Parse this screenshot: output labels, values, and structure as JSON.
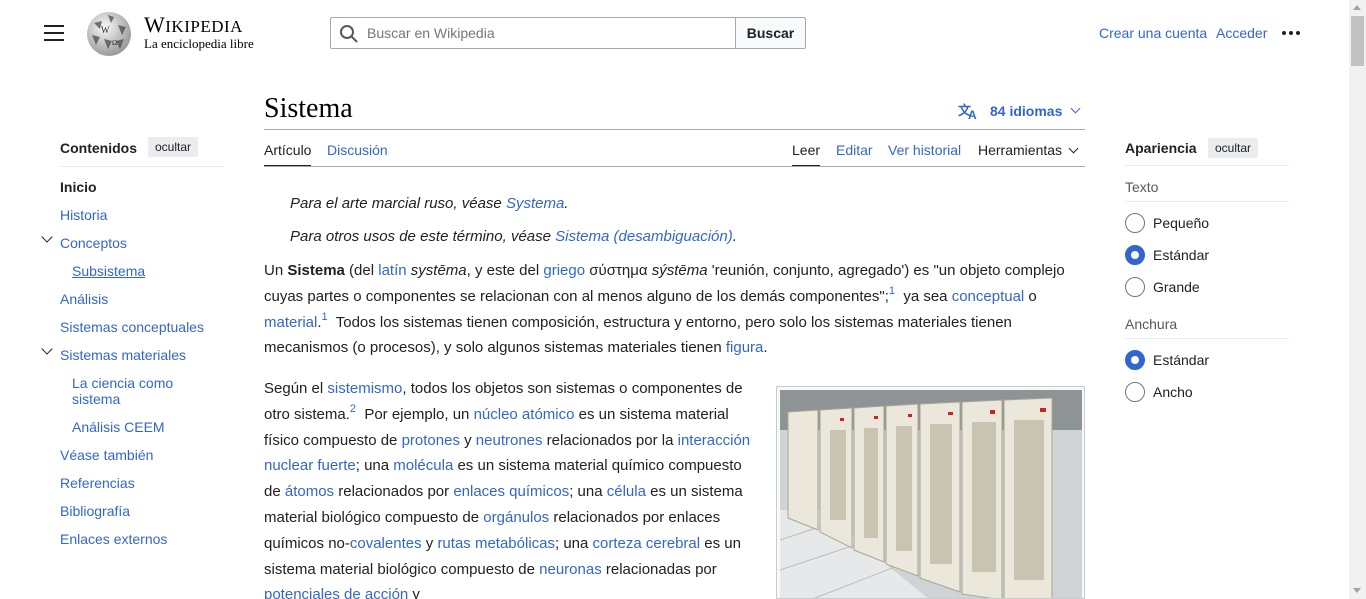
{
  "header": {
    "logo_wordmark": "Wikipedia",
    "logo_tagline": "La enciclopedia libre",
    "search_placeholder": "Buscar en Wikipedia",
    "search_button": "Buscar",
    "create_account": "Crear una cuenta",
    "login": "Acceder"
  },
  "article": {
    "title": "Sistema",
    "languages": "84 idiomas",
    "tabs": {
      "article": "Artículo",
      "talk": "Discusión",
      "read": "Leer",
      "edit": "Editar",
      "history": "Ver historial",
      "tools": "Herramientas"
    },
    "hatnote1": {
      "pre": "Para el arte marcial ruso, véase ",
      "link": "Systema",
      "post": "."
    },
    "hatnote2": {
      "pre": "Para otros usos de este término, véase ",
      "link": "Sistema (desambiguación)",
      "post": "."
    }
  },
  "toc": {
    "title": "Contenidos",
    "hide": "ocultar",
    "items": [
      "Inicio",
      "Historia",
      "Conceptos",
      "Subsistema",
      "Análisis",
      "Sistemas conceptuales",
      "Sistemas materiales",
      "La ciencia como",
      "sistema",
      "Análisis CEEM",
      "Véase también",
      "Referencias",
      "Bibliografía",
      "Enlaces externos"
    ]
  },
  "appearance": {
    "title": "Apariencia",
    "hide": "ocultar",
    "text_label": "Texto",
    "text_options": [
      "Pequeño",
      "Estándar",
      "Grande"
    ],
    "text_selected": "Estándar",
    "width_label": "Anchura",
    "width_options": [
      "Estándar",
      "Ancho"
    ],
    "width_selected": "Estándar"
  },
  "colors": {
    "link": "#3366cc",
    "text": "#202122",
    "radio_checked": "#3366cc"
  },
  "icons": [
    "menu-icon",
    "wikipedia-globe-logo",
    "search-icon",
    "translate-icon",
    "chevron-down-icon",
    "more-icon"
  ]
}
